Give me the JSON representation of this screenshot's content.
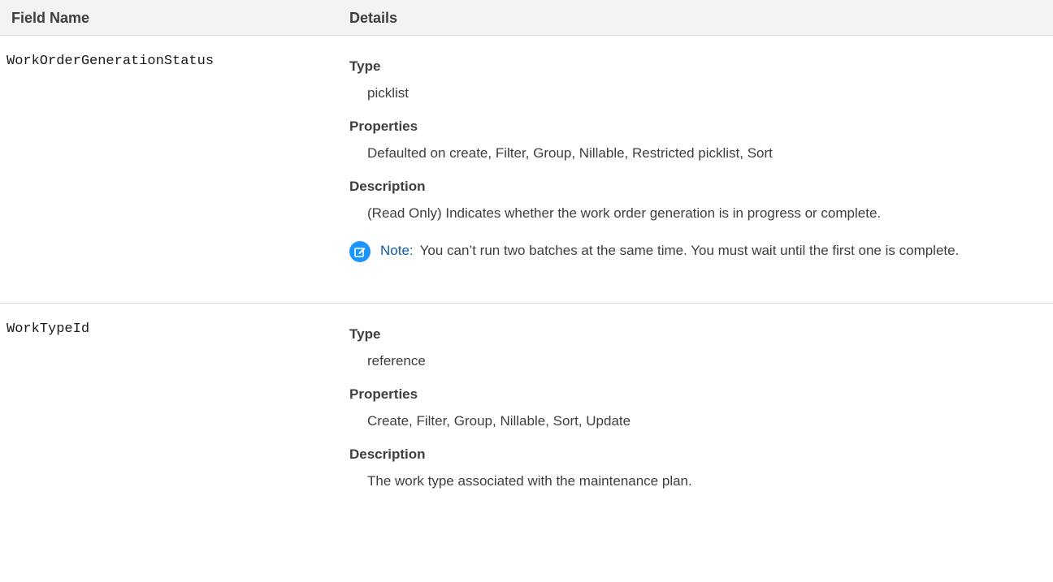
{
  "header": {
    "field_name": "Field Name",
    "details": "Details"
  },
  "rows": [
    {
      "field": "WorkOrderGenerationStatus",
      "type_label": "Type",
      "type_value": "picklist",
      "properties_label": "Properties",
      "properties_value": "Defaulted on create, Filter, Group, Nillable, Restricted picklist, Sort",
      "description_label": "Description",
      "description_value": "(Read Only) Indicates whether the work order generation is in progress or complete.",
      "note_label": "Note:",
      "note_text": "You can’t run two batches at the same time. You must wait until the first one is complete."
    },
    {
      "field": "WorkTypeId",
      "type_label": "Type",
      "type_value": "reference",
      "properties_label": "Properties",
      "properties_value": "Create, Filter, Group, Nillable, Sort, Update",
      "description_label": "Description",
      "description_value": "The work type associated with the maintenance plan."
    }
  ],
  "icons": {
    "note_icon": "edit-note-icon"
  },
  "colors": {
    "note_accent": "#1b96ff",
    "note_label": "#0b5cab",
    "header_bg": "#f3f3f3"
  }
}
